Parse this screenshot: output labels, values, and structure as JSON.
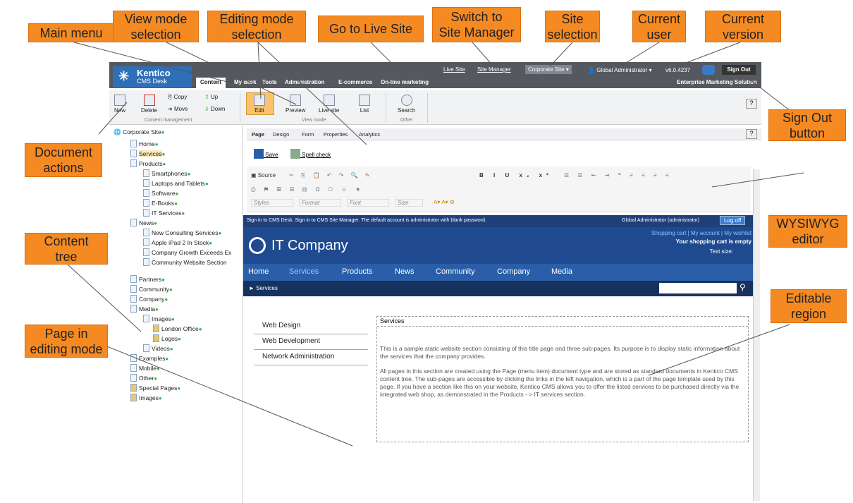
{
  "header": {
    "logo_title": "Kentico",
    "logo_subtitle": "CMS Desk",
    "tabs": [
      "Content",
      "My desk",
      "Tools",
      "Administration",
      "E-commerce",
      "On-line marketing"
    ],
    "live_site": "Live Site",
    "site_manager": "Site Manager",
    "site_selector": "Corporate Site",
    "user": "Global Administrator",
    "version": "v6.0.4237",
    "sign_out": "Sign Out",
    "edition": "Enterprise Marketing Solution"
  },
  "ribbon": {
    "new": "New",
    "delete": "Delete",
    "copy": "Copy",
    "move": "Move",
    "up": "Up",
    "down": "Down",
    "group_content": "Content management",
    "edit": "Edit",
    "preview": "Preview",
    "livesite": "Live site",
    "list": "List",
    "group_view": "View mode",
    "search": "Search",
    "group_other": "Other",
    "help": "?"
  },
  "tree": {
    "root": "Corporate Site",
    "items": [
      "Home",
      "Services",
      "Products",
      "Smartphones",
      "Laptops and Tablets",
      "Software",
      "E-Books",
      "IT Services",
      "News",
      "New Consulting Services",
      "Apple iPad 2 In Stock",
      "Company Growth Exceeds Ex",
      "Community Website Section",
      "Partners",
      "Community",
      "Company",
      "Media",
      "Images",
      "London Office",
      "Logos",
      "Videos",
      "Examples",
      "Mobile",
      "Other",
      "Special Pages",
      "Images"
    ]
  },
  "page_tabs": [
    "Page",
    "Design",
    "Form",
    "Properties",
    "Analytics"
  ],
  "actions": {
    "save": "Save",
    "spell": "Spell check"
  },
  "editor": {
    "source": "Source",
    "styles": "Styles",
    "format": "Format",
    "font": "Font",
    "size": "Size"
  },
  "site": {
    "signin_text": "Sign in to CMS Desk. Sign in to CMS Site Manager. The default account is administrator with blank password.",
    "user_info": "Global Administrator (administrator)",
    "logoff": "Log off",
    "company": "IT Company",
    "cart_links": "Shopping cart | My account | My wishlist",
    "cart_status": "Your shopping cart is empty",
    "text_size": "Text size:",
    "nav": [
      "Home",
      "Services",
      "Products",
      "News",
      "Community",
      "Company",
      "Media"
    ],
    "breadcrumb": "► Services",
    "left_nav": [
      "Web Design",
      "Web Development",
      "Network Administration"
    ],
    "region_title": "Services",
    "para1": "This is a sample static website section consisting of this title page and three sub-pages. Its purpose is to display static information about the services that the company provides.",
    "para2": "All pages in this section are created using the Page (menu item) document type and are stored as standard documents in Kentico CMS content tree. The sub-pages are accessible by clicking the links in the left navigation, which is a part of the page template used by this page. If you have a section like this on your website, Kentico CMS allows you to offer the listed services to be purchased directly via the integrated web shop, as demonstrated in the Products - > IT services section."
  },
  "callouts": {
    "main_menu": "Main menu",
    "view_mode": "View mode\nselection",
    "editing_mode": "Editing mode\nselection",
    "live_site": "Go to Live Site",
    "site_manager": "Switch to\nSite Manager",
    "site_sel": "Site\nselection",
    "cur_user": "Current\nuser",
    "cur_version": "Current\nversion",
    "sign_out": "Sign Out\nbutton",
    "doc_actions": "Document\nactions",
    "content_tree": "Content\ntree",
    "wysiwyg": "WYSIWYG\neditor",
    "editable": "Editable\nregion",
    "page_edit": "Page in\nediting mode"
  }
}
